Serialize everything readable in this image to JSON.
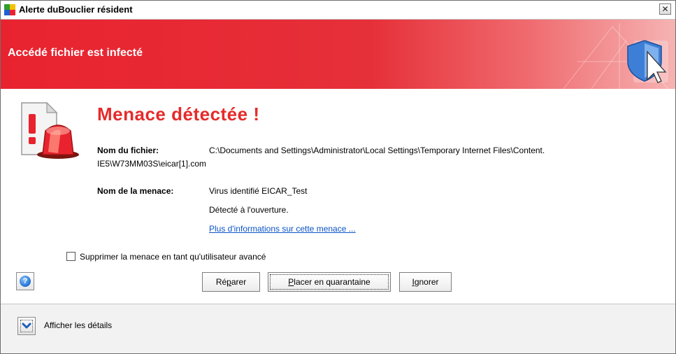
{
  "window": {
    "title": "Alerte duBouclier résident",
    "close_label": "✕"
  },
  "banner": {
    "title": "Accédé fichier est infecté"
  },
  "threat": {
    "heading": "Menace détectée !",
    "file_label": "Nom du fichier:",
    "file_path_line1": "C:\\Documents and Settings\\Administrator\\Local Settings\\Temporary Internet Files\\Content.",
    "file_path_line2": "IE5\\W73MM03S\\eicar[1].com",
    "threat_label": "Nom de la menace:",
    "threat_name": "Virus identifié EICAR_Test",
    "detection_note": "Détecté à l'ouverture.",
    "more_info_link": "Plus d'informations sur cette menace ..."
  },
  "options": {
    "advanced_checkbox_label": "Supprimer la menace en tant qu'utilisateur avancé",
    "advanced_checkbox_checked": false
  },
  "buttons": {
    "repair": {
      "before": "Ré",
      "accel": "p",
      "after": "arer"
    },
    "quarantine": {
      "before": "",
      "accel": "P",
      "after": "lacer en quarantaine"
    },
    "ignore": {
      "before": "",
      "accel": "I",
      "after": "gnorer"
    }
  },
  "details": {
    "toggle_label": "Afficher les détails"
  },
  "colors": {
    "banner_red": "#e8232f",
    "heading_red": "#e52b2b",
    "link_blue": "#0b53c6"
  }
}
